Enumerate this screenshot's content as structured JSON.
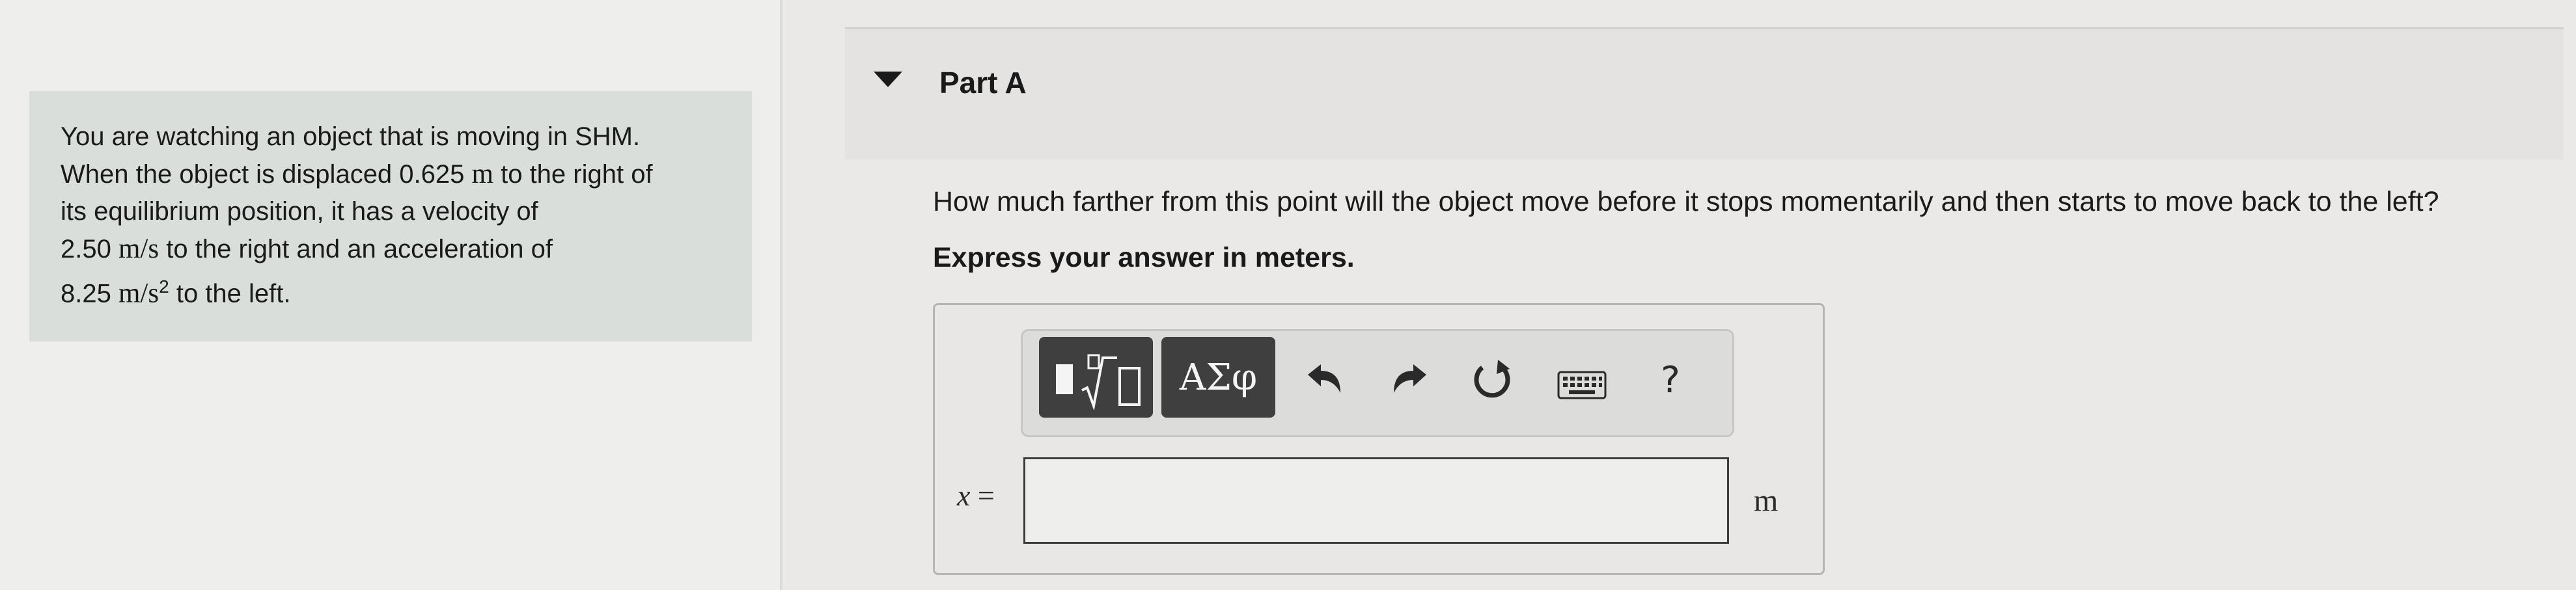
{
  "problem": {
    "line1": "You are watching an object that is moving in SHM.",
    "line2_pre": "When the object is displaced 0.625",
    "line2_unit": "m",
    "line2_post": "to the right of",
    "line3": "its equilibrium position, it has a velocity of",
    "line4_value": "2.50",
    "line4_unit": "m/s",
    "line4_post": "to the right and an acceleration of",
    "line5_value": "8.25",
    "line5_unit": "m/s",
    "line5_exp": "2",
    "line5_post": "to the left."
  },
  "part": {
    "title": "Part A",
    "question": "How much farther from this point will the object move before it stops momentarily and then starts to move back to the left?",
    "instruction": "Express your answer in meters."
  },
  "toolbar": {
    "templates_icon": "templates-sqrt-icon",
    "symbols_label": "ΑΣφ",
    "undo_icon": "undo-icon",
    "redo_icon": "redo-icon",
    "reset_icon": "reset-icon",
    "keyboard_icon": "keyboard-icon",
    "help_label": "?"
  },
  "answer": {
    "variable": "x",
    "equals": "=",
    "value": "",
    "unit": "m"
  }
}
